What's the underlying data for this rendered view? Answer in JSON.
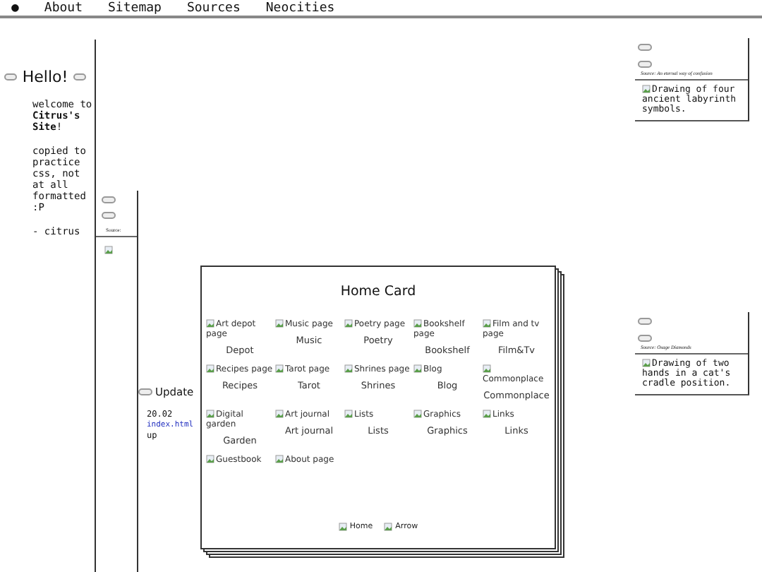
{
  "nav": {
    "bullet": "●",
    "items": [
      "About",
      "Sitemap",
      "Sources",
      "Neocities"
    ]
  },
  "hello": {
    "title": "Hello!",
    "paragraphs": [
      "welcome to **Citrus's Site**!",
      "copied to practice css, not at all formatted :P",
      "- citrus"
    ]
  },
  "side_box": {
    "caption": "Source:"
  },
  "updates": {
    "title": "Update",
    "entries": [
      {
        "date": "20.02",
        "link": "index.html",
        "text": "up"
      }
    ]
  },
  "figures": [
    {
      "caption": "Source: An eternal way of confusion",
      "alt": "Drawing of four ancient labyrinth symbols."
    },
    {
      "caption": "Source: Osage Diamonds",
      "alt": "Drawing of two hands in a cat's cradle position."
    }
  ],
  "home_card": {
    "title": "Home Card",
    "links": [
      {
        "alt": "Art depot page",
        "label": "Depot"
      },
      {
        "alt": "Music page",
        "label": "Music"
      },
      {
        "alt": "Poetry page",
        "label": "Poetry"
      },
      {
        "alt": "Bookshelf page",
        "label": "Bookshelf"
      },
      {
        "alt": "Film and tv page",
        "label": "Film&Tv"
      },
      {
        "alt": "Recipes page",
        "label": "Recipes"
      },
      {
        "alt": "Tarot page",
        "label": "Tarot"
      },
      {
        "alt": "Shrines page",
        "label": "Shrines"
      },
      {
        "alt": "Blog",
        "label": "Blog"
      },
      {
        "alt": "Commonplace",
        "label": "Commonplace"
      },
      {
        "alt": "Digital garden",
        "label": "Garden"
      },
      {
        "alt": "Art journal",
        "label": "Art journal"
      },
      {
        "alt": "Lists",
        "label": "Lists"
      },
      {
        "alt": "Graphics",
        "label": "Graphics"
      },
      {
        "alt": "Links",
        "label": "Links"
      },
      {
        "alt": "Guestbook"
      },
      {
        "alt": "About page"
      }
    ],
    "footer": [
      "Home",
      "Arrow"
    ]
  }
}
